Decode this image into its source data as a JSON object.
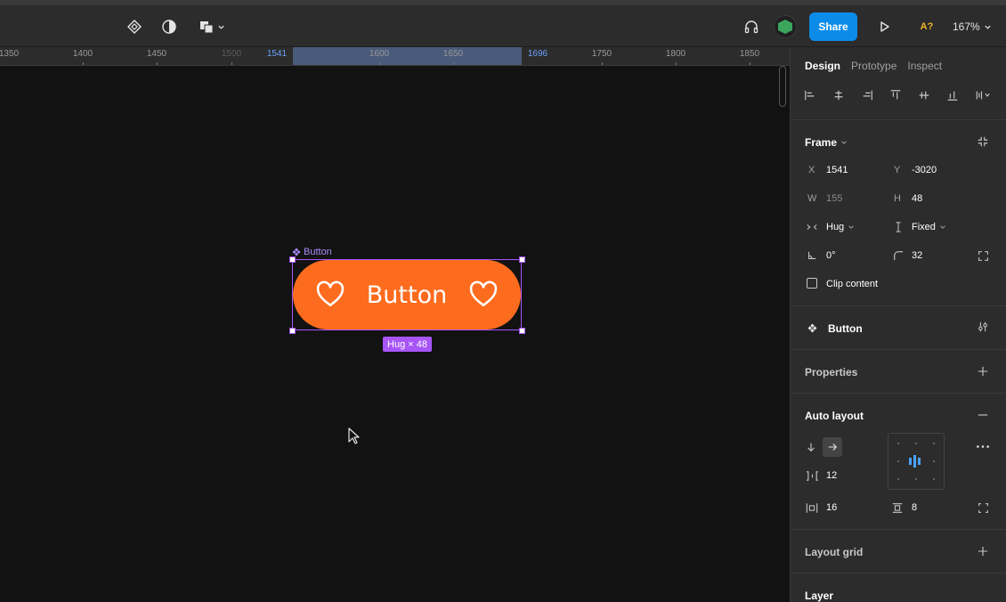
{
  "toolbar": {
    "share_label": "Share",
    "ai_badge": "A?",
    "zoom_label": "167%"
  },
  "ruler": {
    "ticks": [
      "1350",
      "1400",
      "1450",
      "1500",
      "1541",
      "1600",
      "1650",
      "1696",
      "1750",
      "1800",
      "1850"
    ]
  },
  "canvas": {
    "frame_label": "Button",
    "button_label": "Button",
    "size_badge": "Hug × 48",
    "button_color": "#fd6c1e",
    "selection_color": "#a855f7"
  },
  "panel": {
    "tabs": [
      {
        "label": "Design"
      },
      {
        "label": "Prototype"
      },
      {
        "label": "Inspect"
      }
    ],
    "frame": {
      "title": "Frame",
      "x_label": "X",
      "x_value": "1541",
      "y_label": "Y",
      "y_value": "-3020",
      "w_label": "W",
      "w_value": "155",
      "h_label": "H",
      "h_value": "48",
      "width_mode": "Hug",
      "height_mode": "Fixed",
      "rotation": "0°",
      "radius": "32",
      "clip_label": "Clip content"
    },
    "component": {
      "name": "Button"
    },
    "properties": {
      "title": "Properties"
    },
    "auto_layout": {
      "title": "Auto layout",
      "gap": "12",
      "h_padding": "16",
      "v_padding": "8"
    },
    "layout_grid": {
      "title": "Layout grid"
    },
    "layer": {
      "title": "Layer"
    }
  }
}
